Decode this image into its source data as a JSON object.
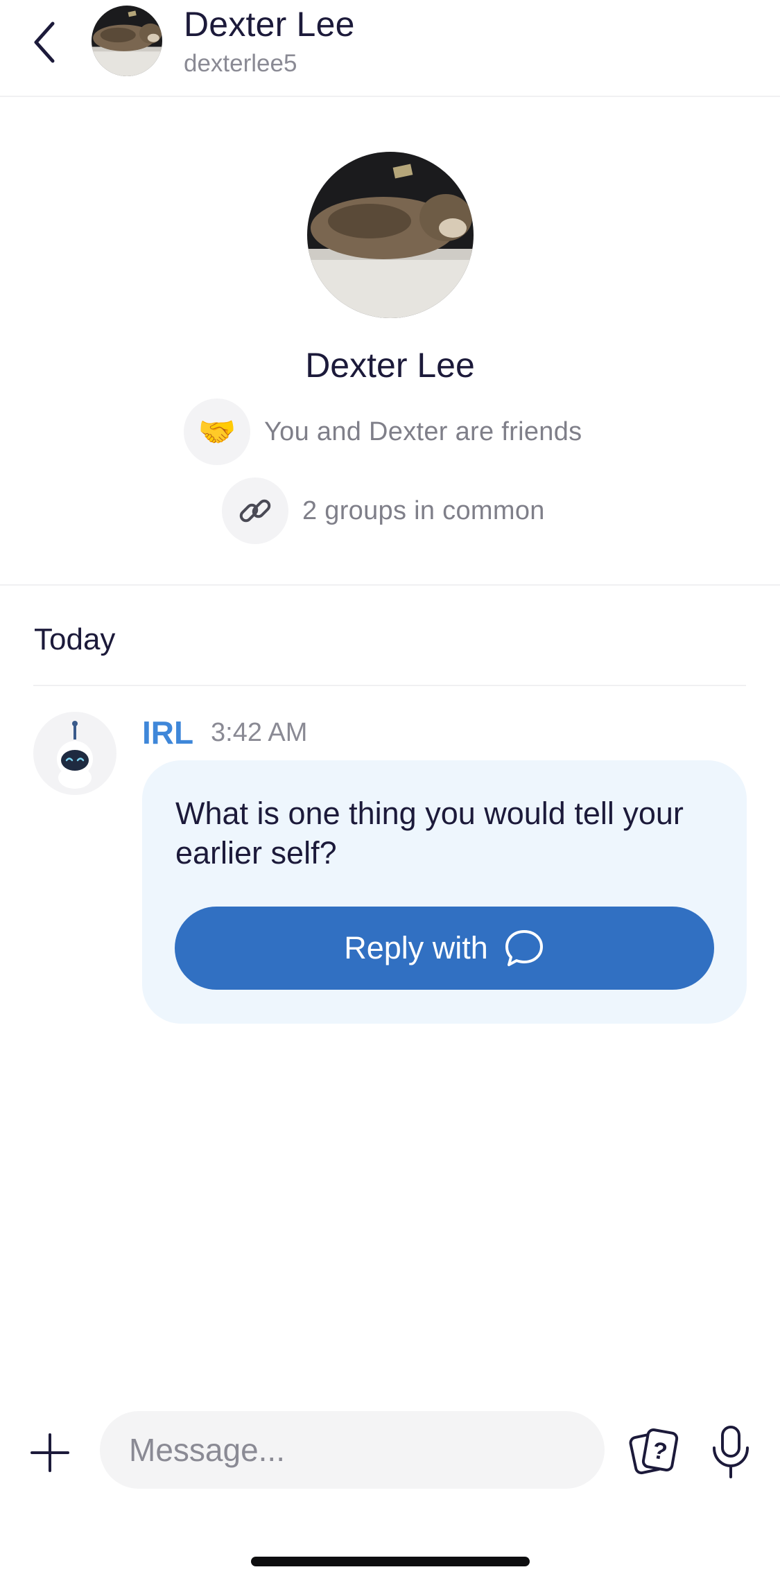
{
  "header": {
    "name": "Dexter Lee",
    "username": "dexterlee5"
  },
  "profile": {
    "name": "Dexter Lee",
    "friends_text": "You and Dexter are friends",
    "friends_icon": "🤝",
    "groups_text": "2 groups in common",
    "groups_icon": "🔗"
  },
  "chat": {
    "date_label": "Today",
    "messages": [
      {
        "sender": "IRL",
        "time": "3:42 AM",
        "text": "What is one thing you would tell your earlier self?",
        "button_label": "Reply with"
      }
    ]
  },
  "composer": {
    "placeholder": "Message..."
  },
  "colors": {
    "accent": "#3170c2",
    "sender": "#3f87d9",
    "bubble": "#eef6fd"
  }
}
